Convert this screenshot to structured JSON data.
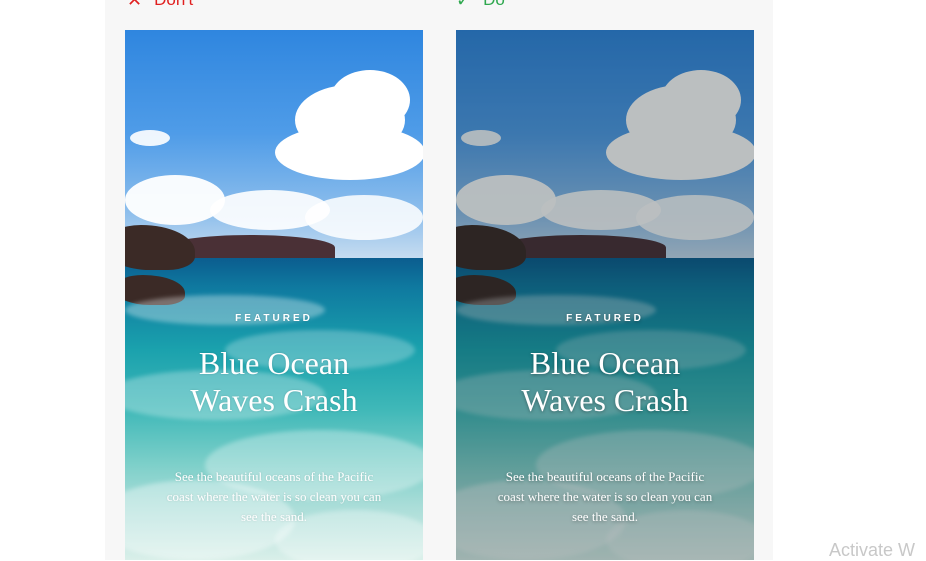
{
  "labels": {
    "dont_mark": "✕",
    "dont_text": "Don't",
    "do_mark": "✓",
    "do_text": "Do"
  },
  "cards": [
    {
      "eyebrow": "FEATURED",
      "title_line1": "Blue Ocean",
      "title_line2": "Waves Crash",
      "description": "See the beautiful oceans of the Pacific coast where the water is so clean you can see the sand."
    },
    {
      "eyebrow": "FEATURED",
      "title_line1": "Blue Ocean",
      "title_line2": "Waves Crash",
      "description": "See the beautiful oceans of the Pacific coast where the water is so clean you can see the sand."
    }
  ],
  "watermark": "Activate W",
  "colors": {
    "dont": "#e02020",
    "do": "#2fa84f"
  }
}
